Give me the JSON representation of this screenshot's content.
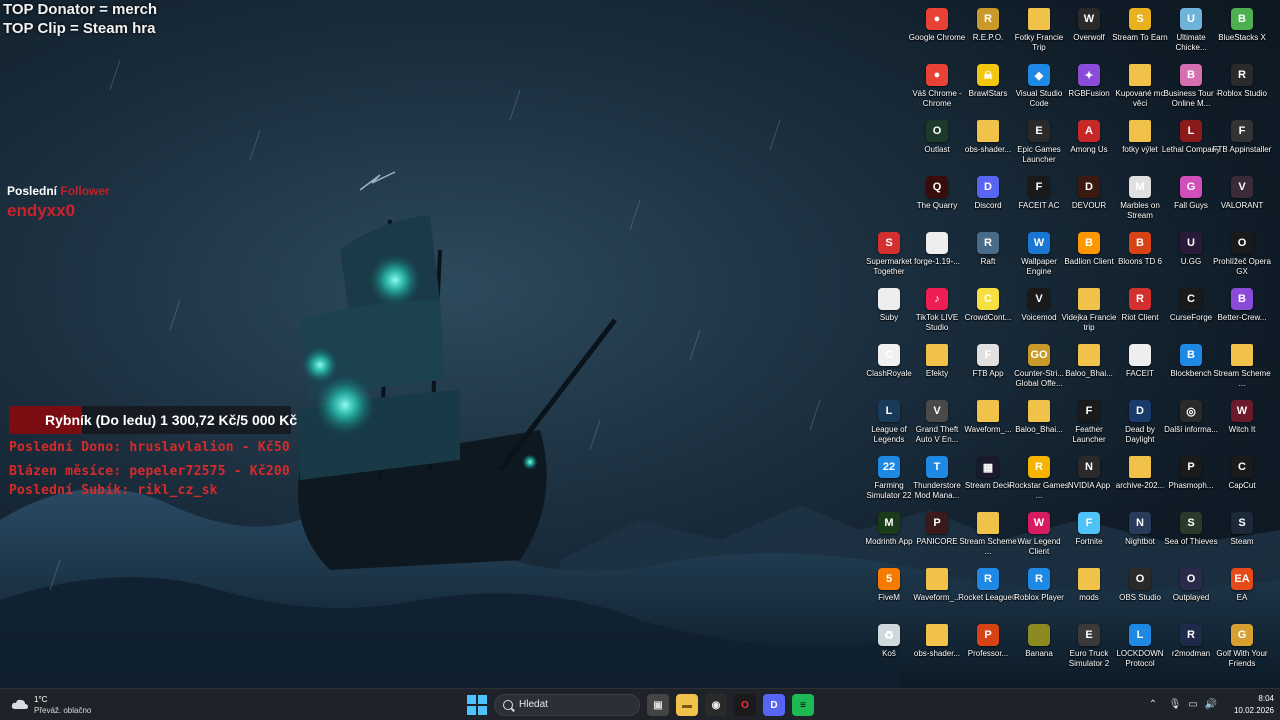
{
  "overlay": {
    "top_donator": "TOP Donator = merch",
    "top_clip": "TOP Clip = Steam hra",
    "last_follower_label": "Poslední",
    "last_follower_label2": "Follower",
    "last_follower_name": "endyxx0",
    "goal_text": "Rybník (Do ledu)  1 300,72 Kč/5 000 Kč",
    "goal_progress": 0.26,
    "last_donation": "Poslední Dono: hruslavlalion - Kč50",
    "month_crazy": "Blázen měsíce: pepeler72575 - Kč200",
    "last_sub": "Poslední Subík: rikl_cz_sk"
  },
  "desktop_icons": [
    {
      "label": "Google Chrome",
      "icon": "chrome-icon",
      "color": "#e94235",
      "glyph": "●"
    },
    {
      "label": "R.E.P.O.",
      "icon": "repo-icon",
      "color": "#c99a2a",
      "glyph": "R"
    },
    {
      "label": "Fotky Francie Trip",
      "icon": "folder-icon",
      "color": "#f0c24a",
      "glyph": ""
    },
    {
      "label": "Overwolf",
      "icon": "overwolf-icon",
      "color": "#2a2a2a",
      "glyph": "W"
    },
    {
      "label": "Stream To Earn",
      "icon": "stream-to-earn-icon",
      "color": "#e8b21f",
      "glyph": "S"
    },
    {
      "label": "Ultimate Chicke...",
      "icon": "ultimate-chicken-icon",
      "color": "#6fb4d8",
      "glyph": "U"
    },
    {
      "label": "BlueStacks X",
      "icon": "bluestacks-icon",
      "color": "#4caf50",
      "glyph": "B"
    },
    {
      "label": "Váš Chrome - Chrome",
      "icon": "chrome-icon",
      "color": "#e94235",
      "glyph": "●"
    },
    {
      "label": "BrawlStars",
      "icon": "brawlstars-icon",
      "color": "#f2c80f",
      "glyph": "☠"
    },
    {
      "label": "Visual Studio Code",
      "icon": "vscode-icon",
      "color": "#1e88e5",
      "glyph": "◆"
    },
    {
      "label": "RGBFusion",
      "icon": "rgbfusion-icon",
      "color": "#8a4bd8",
      "glyph": "✦"
    },
    {
      "label": "Kupované mc věci",
      "icon": "folder-icon",
      "color": "#f0c24a",
      "glyph": ""
    },
    {
      "label": "Business Tour - Online M...",
      "icon": "business-tour-icon",
      "color": "#d66fb0",
      "glyph": "B"
    },
    {
      "label": "Roblox Studio",
      "icon": "roblox-studio-icon",
      "color": "#2a2a2a",
      "glyph": "R"
    },
    {
      "label": "Outlast",
      "icon": "outlast-icon",
      "color": "#1c3a2a",
      "glyph": "O"
    },
    {
      "label": "obs-shader...",
      "icon": "folder-icon",
      "color": "#f0c24a",
      "glyph": ""
    },
    {
      "label": "Epic Games Launcher",
      "icon": "epic-games-icon",
      "color": "#2a2a2a",
      "glyph": "E"
    },
    {
      "label": "Among Us",
      "icon": "among-us-icon",
      "color": "#c62828",
      "glyph": "A"
    },
    {
      "label": "fotky výlet",
      "icon": "folder-icon",
      "color": "#f0c24a",
      "glyph": ""
    },
    {
      "label": "Lethal Company",
      "icon": "lethal-company-icon",
      "color": "#8b1a1a",
      "glyph": "L"
    },
    {
      "label": "FTB Appinstaller",
      "icon": "ftb-icon",
      "color": "#333",
      "glyph": "F"
    },
    {
      "label": "The Quarry",
      "icon": "the-quarry-icon",
      "color": "#3a0d0d",
      "glyph": "Q"
    },
    {
      "label": "Discord",
      "icon": "discord-icon",
      "color": "#5865f2",
      "glyph": "D"
    },
    {
      "label": "FACEIT AC",
      "icon": "faceit-ac-icon",
      "color": "#1a1a1a",
      "glyph": "F"
    },
    {
      "label": "DEVOUR",
      "icon": "devour-icon",
      "color": "#3a1a10",
      "glyph": "D"
    },
    {
      "label": "Marbles on Stream",
      "icon": "marbles-icon",
      "color": "#e0e0e0",
      "glyph": "M"
    },
    {
      "label": "Fall Guys",
      "icon": "fall-guys-icon",
      "color": "#d04fb8",
      "glyph": "G"
    },
    {
      "label": "VALORANT",
      "icon": "valorant-icon",
      "color": "#3a2a3a",
      "glyph": "V"
    },
    {
      "label": "Supermarket Together",
      "icon": "supermarket-icon",
      "color": "#d32f2f",
      "glyph": "S"
    },
    {
      "label": "forge-1.19-...",
      "icon": "file-icon",
      "color": "#eeeeee",
      "glyph": ""
    },
    {
      "label": "Raft",
      "icon": "raft-icon",
      "color": "#4a6a8a",
      "glyph": "R"
    },
    {
      "label": "Wallpaper Engine",
      "icon": "wallpaper-engine-icon",
      "color": "#1976d2",
      "glyph": "W"
    },
    {
      "label": "Badlion Client",
      "icon": "badlion-icon",
      "color": "#ff9800",
      "glyph": "B"
    },
    {
      "label": "Bloons TD 6",
      "icon": "bloons-icon",
      "color": "#d84315",
      "glyph": "B"
    },
    {
      "label": "U.GG",
      "icon": "ugg-icon",
      "color": "#2a1a3a",
      "glyph": "U"
    },
    {
      "label": "Prohlížeč Opera GX",
      "icon": "opera-gx-icon",
      "color": "#1a1a1a",
      "glyph": "O"
    },
    {
      "label": "Suby",
      "icon": "file-icon",
      "color": "#eeeeee",
      "glyph": ""
    },
    {
      "label": "TikTok LIVE Studio",
      "icon": "tiktok-icon",
      "color": "#ee1d52",
      "glyph": "♪"
    },
    {
      "label": "CrowdCont...",
      "icon": "crowdcontrol-icon",
      "color": "#f5e040",
      "glyph": "C"
    },
    {
      "label": "Voicemod",
      "icon": "voicemod-icon",
      "color": "#1a1a1a",
      "glyph": "V"
    },
    {
      "label": "Videjka Francie trip",
      "icon": "folder-icon",
      "color": "#f0c24a",
      "glyph": ""
    },
    {
      "label": "Riot Client",
      "icon": "riot-client-icon",
      "color": "#d32f2f",
      "glyph": "R"
    },
    {
      "label": "CurseForge",
      "icon": "curseforge-icon",
      "color": "#1a1a1a",
      "glyph": "C"
    },
    {
      "label": "Better-Crew...",
      "icon": "better-crew-icon",
      "color": "#8a4bd8",
      "glyph": "B"
    },
    {
      "label": "ClashRoyale",
      "icon": "clash-royale-icon",
      "color": "#f0f0f0",
      "glyph": "C"
    },
    {
      "label": "Efekty",
      "icon": "folder-icon",
      "color": "#f0c24a",
      "glyph": ""
    },
    {
      "label": "FTB App",
      "icon": "ftb-app-icon",
      "color": "#e0e0e0",
      "glyph": "F"
    },
    {
      "label": "Counter-Stri... Global Offe...",
      "icon": "csgo-icon",
      "color": "#c99a2a",
      "glyph": "GO"
    },
    {
      "label": "Baloo_Bhai...",
      "icon": "folder-icon",
      "color": "#f0c24a",
      "glyph": ""
    },
    {
      "label": "FACEIT",
      "icon": "file-icon",
      "color": "#eeeeee",
      "glyph": ""
    },
    {
      "label": "Blockbench",
      "icon": "blockbench-icon",
      "color": "#1e88e5",
      "glyph": "B"
    },
    {
      "label": "Stream Scheme ...",
      "icon": "folder-icon",
      "color": "#f0c24a",
      "glyph": ""
    },
    {
      "label": "League of Legends",
      "icon": "league-icon",
      "color": "#1a3a5a",
      "glyph": "L"
    },
    {
      "label": "Grand Theft Auto V En...",
      "icon": "gta-icon",
      "color": "#4a4a4a",
      "glyph": "V"
    },
    {
      "label": "Waveform_...",
      "icon": "folder-icon",
      "color": "#f0c24a",
      "glyph": ""
    },
    {
      "label": "Baloo_Bhai...",
      "icon": "folder-icon",
      "color": "#f0c24a",
      "glyph": ""
    },
    {
      "label": "Feather Launcher",
      "icon": "feather-icon",
      "color": "#1a1a1a",
      "glyph": "F"
    },
    {
      "label": "Dead by Daylight",
      "icon": "dbd-icon",
      "color": "#1a3a6a",
      "glyph": "D"
    },
    {
      "label": "Další informa...",
      "icon": "info-icon",
      "color": "#2a2a2a",
      "glyph": "◎"
    },
    {
      "label": "Witch It",
      "icon": "witch-it-icon",
      "color": "#6a1a2a",
      "glyph": "W"
    },
    {
      "label": "Farming Simulator 22",
      "icon": "farming-sim-icon",
      "color": "#1e88e5",
      "glyph": "22"
    },
    {
      "label": "Thunderstore Mod Mana...",
      "icon": "thunderstore-icon",
      "color": "#1e88e5",
      "glyph": "T"
    },
    {
      "label": "Stream Deck",
      "icon": "stream-deck-icon",
      "color": "#1a1a2a",
      "glyph": "▦"
    },
    {
      "label": "Rockstar Games ...",
      "icon": "rockstar-icon",
      "color": "#f5b400",
      "glyph": "R"
    },
    {
      "label": "NVIDIA App",
      "icon": "nvidia-icon",
      "color": "#2a2a2a",
      "glyph": "N"
    },
    {
      "label": "archive-202...",
      "icon": "folder-icon",
      "color": "#f0c24a",
      "glyph": ""
    },
    {
      "label": "Phasmoph...",
      "icon": "phasmophobia-icon",
      "color": "#1a1a1a",
      "glyph": "P"
    },
    {
      "label": "CapCut",
      "icon": "capcut-icon",
      "color": "#1a1a1a",
      "glyph": "C"
    },
    {
      "label": "Modrinth App",
      "icon": "modrinth-icon",
      "color": "#1a3a1a",
      "glyph": "M"
    },
    {
      "label": "PANICORE",
      "icon": "panicore-icon",
      "color": "#3a1a1a",
      "glyph": "P"
    },
    {
      "label": "Stream Scheme ...",
      "icon": "folder-icon",
      "color": "#f0c24a",
      "glyph": ""
    },
    {
      "label": "War Legend Client",
      "icon": "war-legend-icon",
      "color": "#d81b60",
      "glyph": "W"
    },
    {
      "label": "Fortnite",
      "icon": "fortnite-icon",
      "color": "#4fc3f7",
      "glyph": "F"
    },
    {
      "label": "Nightbot",
      "icon": "nightbot-icon",
      "color": "#2a3a5a",
      "glyph": "N"
    },
    {
      "label": "Sea of Thieves",
      "icon": "sea-of-thieves-icon",
      "color": "#2a3a2a",
      "glyph": "S"
    },
    {
      "label": "Steam",
      "icon": "steam-icon",
      "color": "#1b2838",
      "glyph": "S"
    },
    {
      "label": "FiveM",
      "icon": "fivem-icon",
      "color": "#f57c00",
      "glyph": "5"
    },
    {
      "label": "Waveform_...",
      "icon": "folder-icon",
      "color": "#f0c24a",
      "glyph": ""
    },
    {
      "label": "Rocket League®",
      "icon": "rocket-league-icon",
      "color": "#1e88e5",
      "glyph": "R"
    },
    {
      "label": "Roblox Player",
      "icon": "roblox-icon",
      "color": "#1e88e5",
      "glyph": "R"
    },
    {
      "label": "mods",
      "icon": "folder-icon",
      "color": "#f0c24a",
      "glyph": ""
    },
    {
      "label": "OBS Studio",
      "icon": "obs-icon",
      "color": "#2a2a2a",
      "glyph": "O"
    },
    {
      "label": "Outplayed",
      "icon": "outplayed-icon",
      "color": "#2a2a4a",
      "glyph": "O"
    },
    {
      "label": "EA",
      "icon": "ea-icon",
      "color": "#e64a19",
      "glyph": "EA"
    },
    {
      "label": "Koš",
      "icon": "recycle-bin-icon",
      "color": "#cfd8dc",
      "glyph": "♻"
    },
    {
      "label": "obs-shader...",
      "icon": "folder-icon",
      "color": "#f0c24a",
      "glyph": ""
    },
    {
      "label": "Professor...",
      "icon": "professor-icon",
      "color": "#d84315",
      "glyph": "P"
    },
    {
      "label": "Banana",
      "icon": "banana-icon",
      "color": "#8a8a20",
      "glyph": ""
    },
    {
      "label": "Euro Truck Simulator 2",
      "icon": "ets2-icon",
      "color": "#3a3a3a",
      "glyph": "E"
    },
    {
      "label": "LOCKDOWN Protocol",
      "icon": "lockdown-icon",
      "color": "#1e88e5",
      "glyph": "L"
    },
    {
      "label": "r2modman",
      "icon": "r2modman-icon",
      "color": "#1e2a4a",
      "glyph": "R"
    },
    {
      "label": "Golf With Your Friends",
      "icon": "golf-icon",
      "color": "#d8a030",
      "glyph": "G"
    }
  ],
  "taskbar": {
    "weather_temp": "1°C",
    "weather_desc": "Převáž. oblačno",
    "search_label": "Hledat",
    "time": "8:04",
    "date": "10.02.2026",
    "apps": [
      {
        "name": "task-view-icon",
        "glyph": "▣",
        "color": "#444",
        "fg": "#ddd"
      },
      {
        "name": "file-explorer-icon",
        "glyph": "▬",
        "color": "#f0c24a",
        "fg": "#7a5a10"
      },
      {
        "name": "obs-taskbar-icon",
        "glyph": "◉",
        "color": "#2a2a2a",
        "fg": "#eee"
      },
      {
        "name": "opera-taskbar-icon",
        "glyph": "O",
        "color": "#1a1a1a",
        "fg": "#ff2a4a"
      },
      {
        "name": "discord-taskbar-icon",
        "glyph": "D",
        "color": "#5865f2",
        "fg": "#fff"
      },
      {
        "name": "spotify-taskbar-icon",
        "glyph": "≡",
        "color": "#1db954",
        "fg": "#000"
      }
    ]
  }
}
